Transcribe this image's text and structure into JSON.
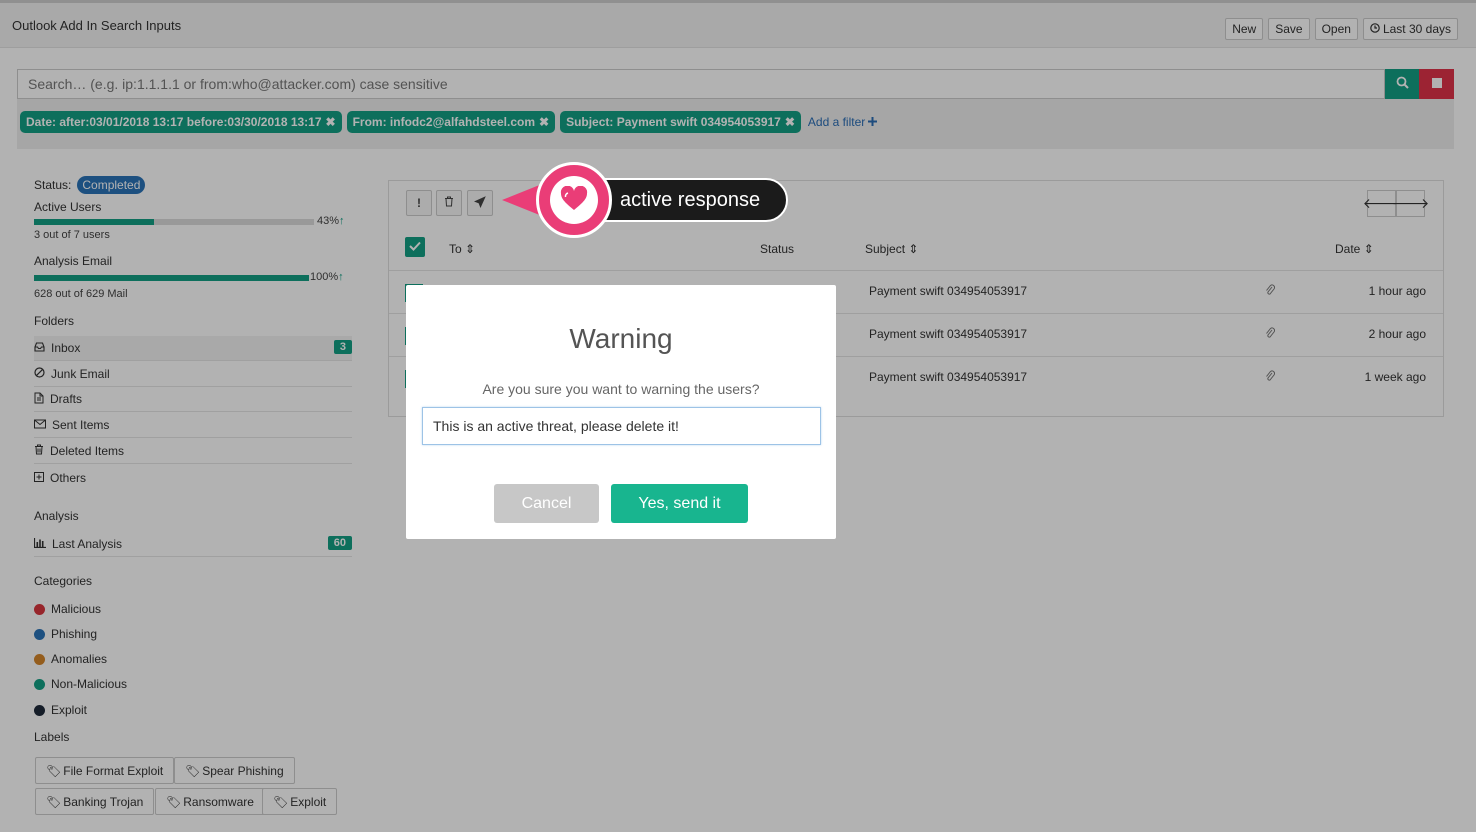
{
  "header": {
    "title": "Outlook Add In Search Inputs",
    "actions": [
      "New",
      "Save",
      "Open",
      "Last 30 days"
    ]
  },
  "search": {
    "placeholder": "Search… (e.g. ip:1.1.1.1 or from:who@attacker.com) case sensitive",
    "filters": [
      "Date: after:03/01/2018 13:17 before:03/30/2018 13:17",
      "From: infodc2@alfahdsteel.com",
      "Subject: Payment swift 034954053917"
    ],
    "add_filter": "Add a filter"
  },
  "sidebar": {
    "status_label": "Status:",
    "status_value": "Completed",
    "active_users": {
      "title": "Active Users",
      "percent": 43,
      "percent_text": "43%",
      "note": "3 out of 7 users"
    },
    "analysis_email": {
      "title": "Analysis Email",
      "percent": 100,
      "percent_text": "100%",
      "note": "628 out of 629 Mail"
    },
    "folders_title": "Folders",
    "folders": [
      {
        "label": "Inbox",
        "icon": "inbox-icon",
        "count": "3"
      },
      {
        "label": "Junk Email",
        "icon": "ban-icon",
        "count": ""
      },
      {
        "label": "Drafts",
        "icon": "file-icon",
        "count": ""
      },
      {
        "label": "Sent Items",
        "icon": "envelope-icon",
        "count": ""
      },
      {
        "label": "Deleted Items",
        "icon": "trash-icon",
        "count": ""
      },
      {
        "label": "Others",
        "icon": "plus-square-icon",
        "count": ""
      }
    ],
    "analysis_title": "Analysis",
    "analysis_item": {
      "label": "Last Analysis",
      "count": "60"
    },
    "categories_title": "Categories",
    "categories": [
      {
        "label": "Malicious",
        "color": "#d9363e"
      },
      {
        "label": "Phishing",
        "color": "#2a73b8"
      },
      {
        "label": "Anomalies",
        "color": "#d4862a"
      },
      {
        "label": "Non-Malicious",
        "color": "#14a085"
      },
      {
        "label": "Exploit",
        "color": "#1f2a3a"
      }
    ],
    "labels_title": "Labels",
    "labels": [
      "File Format Exploit",
      "Spear Phishing",
      "Banking Trojan",
      "Ransomware",
      "Exploit"
    ]
  },
  "table": {
    "headers": {
      "to": "To",
      "status": "Status",
      "subject": "Subject",
      "date": "Date"
    },
    "rows": [
      {
        "subject": "Payment swift 034954053917",
        "date": "1 hour ago"
      },
      {
        "subject": "Payment swift 034954053917",
        "date": "2 hour ago"
      },
      {
        "subject": "Payment swift 034954053917",
        "date": "1 week ago"
      }
    ]
  },
  "callout": {
    "text": "active response"
  },
  "modal": {
    "title": "Warning",
    "message": "Are you sure you want to warning the users?",
    "input_value": "This is an active threat, please delete it!",
    "cancel": "Cancel",
    "confirm": "Yes, send it"
  },
  "colors": {
    "accent": "#14a085",
    "danger": "#e0334a",
    "brand_pink": "#ea3d77",
    "badge_blue": "#2a73b8"
  }
}
